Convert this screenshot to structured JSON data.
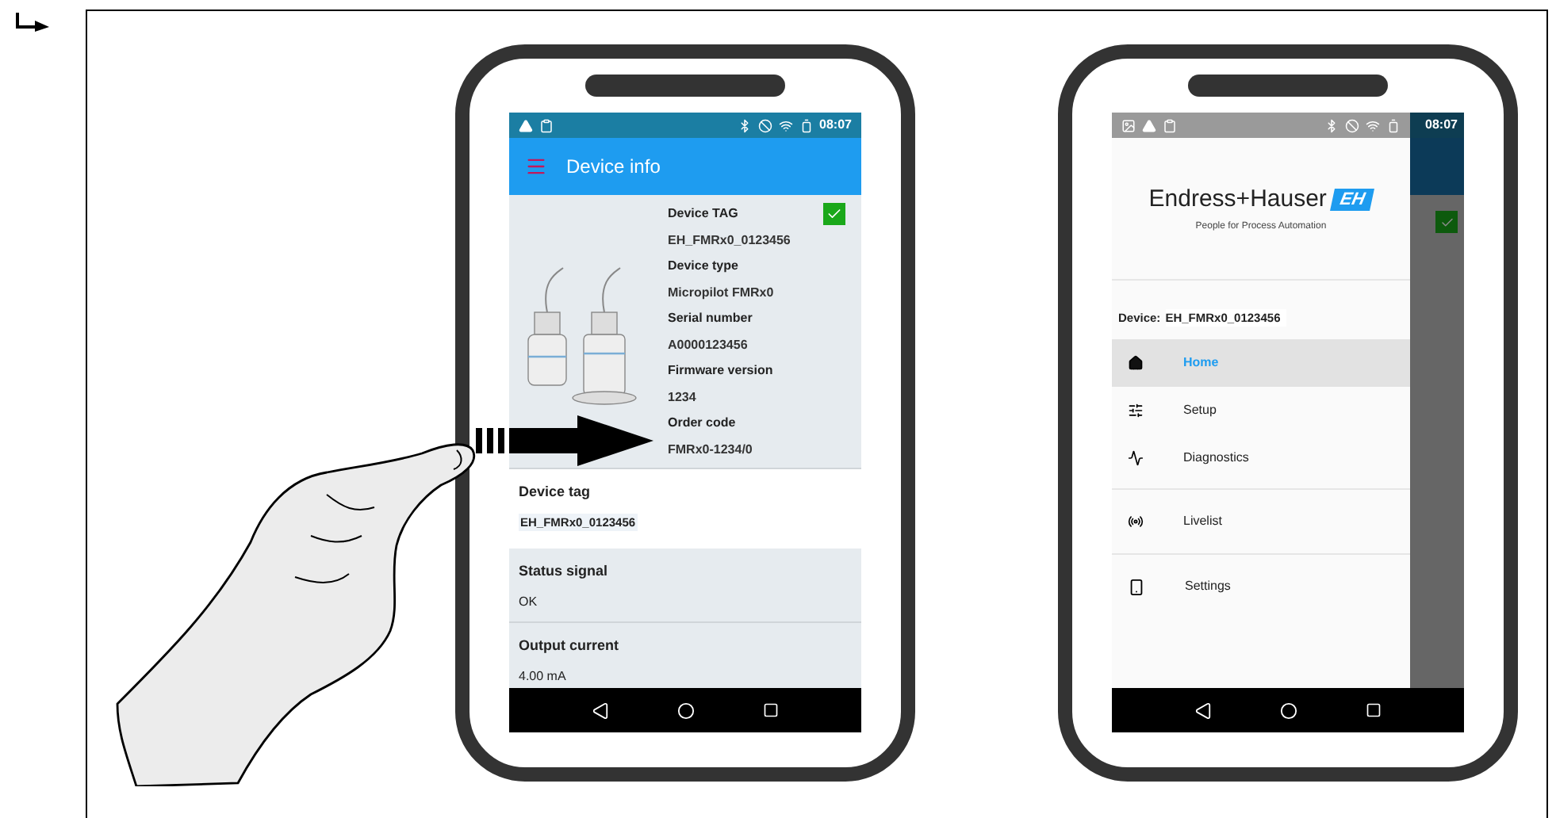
{
  "left_phone": {
    "status_bar": {
      "time": "08:07"
    },
    "app_bar": {
      "title": "Device info"
    },
    "device_info": {
      "checked": true,
      "fields": [
        {
          "label": "Device TAG",
          "value": "EH_FMRx0_0123456"
        },
        {
          "label": "Device type",
          "value": "Micropilot FMRx0"
        },
        {
          "label": "Serial number",
          "value": "A0000123456"
        },
        {
          "label": "Firmware version",
          "value": "1234"
        },
        {
          "label": "Order code",
          "value": "FMRx0-1234/0"
        }
      ]
    },
    "sections": [
      {
        "kind": "field",
        "label": "Device tag",
        "value": "EH_FMRx0_0123456"
      },
      {
        "kind": "text",
        "label": "Status signal",
        "value": "OK"
      },
      {
        "kind": "text",
        "label": "Output current",
        "value": "4.00 mA"
      }
    ]
  },
  "right_phone": {
    "status_bar": {
      "time": "08:07"
    },
    "background_checkbox": {
      "checked": true
    },
    "logo": {
      "name": "Endress+Hauser",
      "mark": "EH",
      "tagline": "People for Process Automation"
    },
    "device": {
      "label": "Device:",
      "value": "EH_FMRx0_0123456"
    },
    "menu_groups": [
      [
        {
          "kind": "home",
          "label": "Home",
          "selected": true
        },
        {
          "kind": "setup",
          "label": "Setup",
          "selected": false
        },
        {
          "kind": "diagnostics",
          "label": "Diagnostics",
          "selected": false
        }
      ],
      [
        {
          "kind": "livelist",
          "label": "Livelist",
          "selected": false
        }
      ],
      [
        {
          "kind": "settings",
          "label": "Settings",
          "selected": false
        }
      ]
    ]
  }
}
